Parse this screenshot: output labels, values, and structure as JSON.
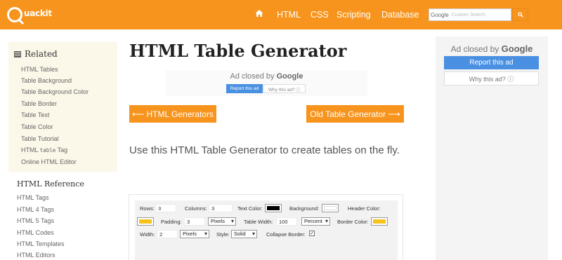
{
  "header": {
    "logo_text": "uackit",
    "nav": [
      "HTML",
      "CSS",
      "Scripting",
      "Database"
    ],
    "search": {
      "google_label": "Google",
      "placeholder": "Custom Search"
    }
  },
  "sidebar": {
    "related_title": "Related",
    "related_items": [
      "HTML Tables",
      "Table Background",
      "Table Background Color",
      "Table Border",
      "Table Text",
      "Table Color",
      "Table Tutorial",
      "Online HTML Editor"
    ],
    "tag_item": {
      "prefix": "HTML",
      "code": "table",
      "suffix": "Tag"
    },
    "reference_title": "HTML Reference",
    "reference_items": [
      "HTML Tags",
      "HTML 4 Tags",
      "HTML 5 Tags",
      "HTML Codes",
      "HTML Templates",
      "HTML Editors"
    ]
  },
  "main": {
    "title": "HTML Table Generator",
    "ad": {
      "closed_by": "Ad closed by",
      "google": "Google",
      "report": "Report this ad",
      "why": "Why this ad? ⓘ"
    },
    "prev_button": "⟵ HTML Generators",
    "next_button": "Old Table Generator ⟶",
    "intro": "Use this HTML Table Generator to create tables on the fly."
  },
  "generator": {
    "rows_label": "Rows:",
    "rows_value": "3",
    "columns_label": "Columns:",
    "columns_value": "3",
    "text_color_label": "Text Color:",
    "background_label": "Background:",
    "header_color_label": "Header Color:",
    "padding_label": "Padding:",
    "padding_value": "3",
    "padding_unit": "Pixels",
    "table_width_label": "Table Width:",
    "table_width_value": "100",
    "table_width_unit": "Percent",
    "border_color_label": "Border Color:",
    "width_label": "Width:",
    "width_value": "2",
    "width_unit": "Pixels",
    "style_label": "Style:",
    "style_value": "Solid",
    "collapse_label": "Collapse Border:",
    "collapse_checked": "✓"
  },
  "right_ad": {
    "closed_by": "Ad closed by",
    "google": "Google",
    "report": "Report this ad",
    "why": "Why this ad? ⓘ"
  },
  "colors": {
    "accent": "#f7941d",
    "text_color": "#000000",
    "background": "#ffffff",
    "header_color": "#f5c21b",
    "border_color": "#f5c21b",
    "ad_button": "#4a90e2"
  }
}
